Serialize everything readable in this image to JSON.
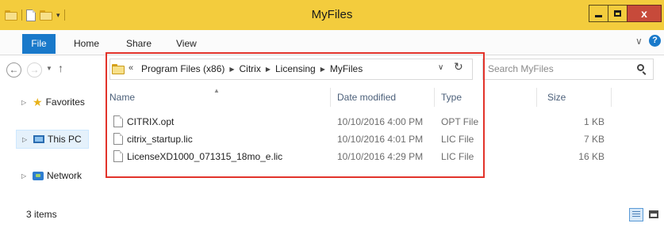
{
  "window": {
    "title": "MyFiles",
    "controls": {
      "minimize": "",
      "maximize": "",
      "close": "x"
    },
    "titlebar_color": "#f3cc3d"
  },
  "quick_access": {
    "icons": [
      "folder-icon",
      "properties-icon",
      "new-folder-icon",
      "customize-dropdown-icon"
    ]
  },
  "ribbon": {
    "tabs": [
      {
        "label": "File",
        "active": true
      },
      {
        "label": "Home"
      },
      {
        "label": "Share"
      },
      {
        "label": "View"
      }
    ],
    "accent": "#1979ca",
    "help": "?"
  },
  "address": {
    "overflow": "«",
    "crumbs": [
      "Program Files (x86)",
      "Citrix",
      "Licensing",
      "MyFiles"
    ]
  },
  "search": {
    "placeholder": "Search MyFiles"
  },
  "nav_pane": {
    "items": [
      {
        "label": "Favorites",
        "icon": "star-icon"
      },
      {
        "label": "This PC",
        "icon": "computer-icon",
        "selected": true
      },
      {
        "label": "Network",
        "icon": "network-icon"
      }
    ]
  },
  "file_list": {
    "columns": [
      "Name",
      "Date modified",
      "Type",
      "Size"
    ],
    "sort_column": "Name",
    "rows": [
      {
        "name": "CITRIX.opt",
        "date": "10/10/2016 4:00 PM",
        "type": "OPT File",
        "size": "1 KB"
      },
      {
        "name": "citrix_startup.lic",
        "date": "10/10/2016 4:01 PM",
        "type": "LIC File",
        "size": "7 KB"
      },
      {
        "name": "LicenseXD1000_071315_18mo_e.lic",
        "date": "10/10/2016 4:29 PM",
        "type": "LIC File",
        "size": "16 KB"
      }
    ]
  },
  "highlight_color": "#e2332a",
  "status": {
    "item_count": "3 items"
  }
}
